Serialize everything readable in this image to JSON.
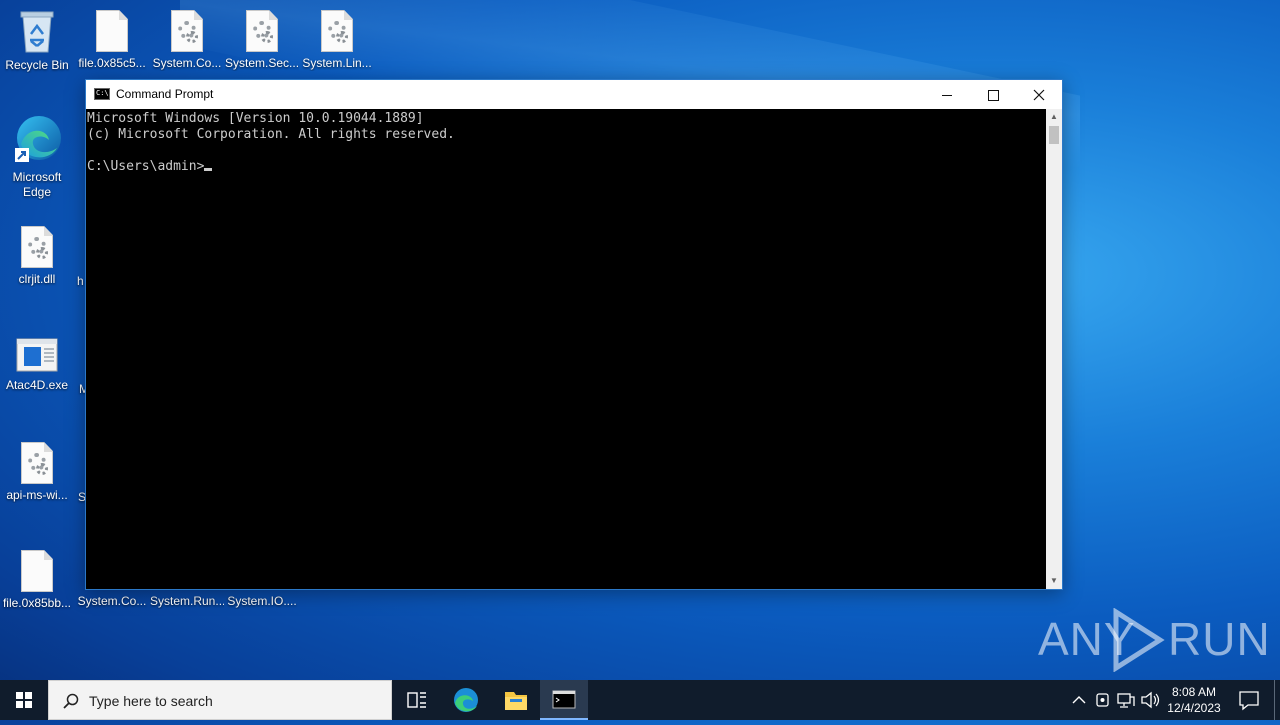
{
  "desktop": {
    "icons": [
      {
        "label": "Recycle Bin",
        "icon": "recycle-bin-icon"
      },
      {
        "label": "file.0x85c5...",
        "icon": "file-icon"
      },
      {
        "label": "System.Co...",
        "icon": "dll-icon"
      },
      {
        "label": "System.Sec...",
        "icon": "dll-icon"
      },
      {
        "label": "System.Lin...",
        "icon": "dll-icon"
      },
      {
        "label": "Microsoft Edge",
        "icon": "edge-icon"
      },
      {
        "label": "clrjit.dll",
        "icon": "dll-icon"
      },
      {
        "label": "Atac4D.exe",
        "icon": "exe-icon"
      },
      {
        "label": "api-ms-wi...",
        "icon": "dll-icon"
      },
      {
        "label": "file.0x85bb...",
        "icon": "file-icon"
      },
      {
        "label": "System.Co...",
        "icon": "dll-icon"
      },
      {
        "label": "System.Run...",
        "icon": "dll-icon"
      },
      {
        "label": "System.IO....",
        "icon": "dll-icon"
      }
    ],
    "partial_labels": [
      "h",
      "M",
      "S"
    ]
  },
  "cmd": {
    "title": "Command Prompt",
    "lines": [
      "Microsoft Windows [Version 10.0.19044.1889]",
      "(c) Microsoft Corporation. All rights reserved.",
      "",
      "C:\\Users\\admin>"
    ]
  },
  "watermark": {
    "left": "ANY",
    "right": "RUN"
  },
  "taskbar": {
    "search_placeholder": "Type here to search",
    "time": "8:08 AM",
    "date": "12/4/2023"
  },
  "colors": {
    "taskbar": "#101c2c",
    "console_bg": "#000000",
    "console_fg": "#cccccc",
    "window_border": "#2b78c8"
  }
}
